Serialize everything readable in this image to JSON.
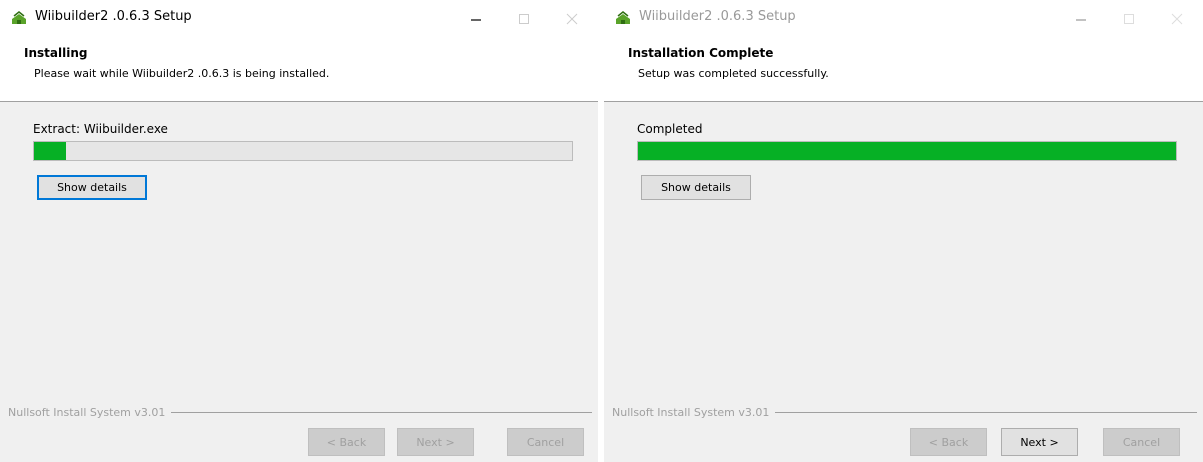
{
  "installing_window": {
    "title": "Wiibuilder2 .0.6.3 Setup",
    "header_title": "Installing",
    "header_subtitle": "Please wait while Wiibuilder2 .0.6.3 is being installed.",
    "status": "Extract: Wiibuilder.exe",
    "progress_percent": 6,
    "show_details_label": "Show details",
    "footer": "Nullsoft Install System v3.01",
    "back_label": "< Back",
    "next_label": "Next >",
    "cancel_label": "Cancel"
  },
  "complete_window": {
    "title": "Wiibuilder2 .0.6.3 Setup",
    "header_title": "Installation Complete",
    "header_subtitle": "Setup was completed successfully.",
    "status": "Completed",
    "progress_percent": 100,
    "show_details_label": "Show details",
    "footer": "Nullsoft Install System v3.01",
    "back_label": "< Back",
    "next_label": "Next >",
    "cancel_label": "Cancel"
  },
  "colors": {
    "progress_green": "#06b025",
    "focus_blue": "#0078d7",
    "dialog_bg": "#f0f0f0"
  },
  "icons": [
    "installer-app-icon",
    "minimize-icon",
    "maximize-icon",
    "close-icon"
  ]
}
